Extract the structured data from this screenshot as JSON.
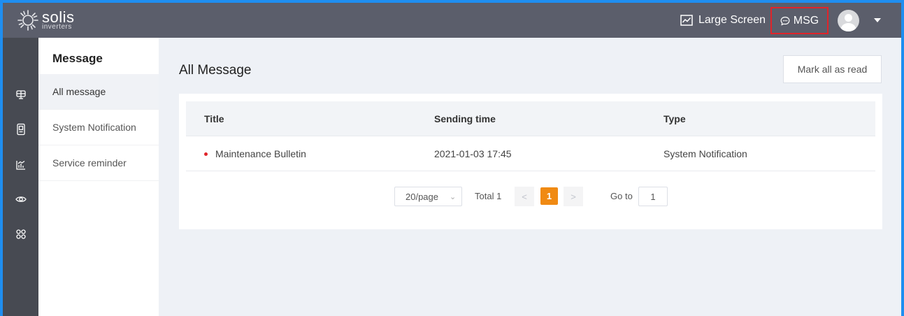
{
  "header": {
    "logo_name": "solis",
    "logo_sub": "inverters",
    "large_screen_label": "Large Screen",
    "msg_label": "MSG"
  },
  "rail": {
    "icons": [
      "plant-icon",
      "device-icon",
      "analytics-icon",
      "monitor-icon",
      "apps-icon"
    ]
  },
  "submenu": {
    "title": "Message",
    "items": [
      {
        "label": "All message",
        "active": true
      },
      {
        "label": "System Notification",
        "active": false
      },
      {
        "label": "Service reminder",
        "active": false
      }
    ]
  },
  "main": {
    "title": "All Message",
    "mark_all_label": "Mark all as read",
    "table": {
      "columns": [
        "Title",
        "Sending time",
        "Type"
      ],
      "rows": [
        {
          "title": "Maintenance Bulletin",
          "sending_time": "2021-01-03 17:45",
          "type": "System Notification",
          "unread": true
        }
      ]
    },
    "pagination": {
      "page_size": "20/page",
      "total": "Total 1",
      "current_page": "1",
      "goto_label": "Go to",
      "goto_value": "1"
    }
  },
  "colors": {
    "accent": "#f08a13",
    "unread_dot": "#e0242a",
    "header_bg": "#5b5e6b",
    "rail_bg": "#474a52"
  }
}
